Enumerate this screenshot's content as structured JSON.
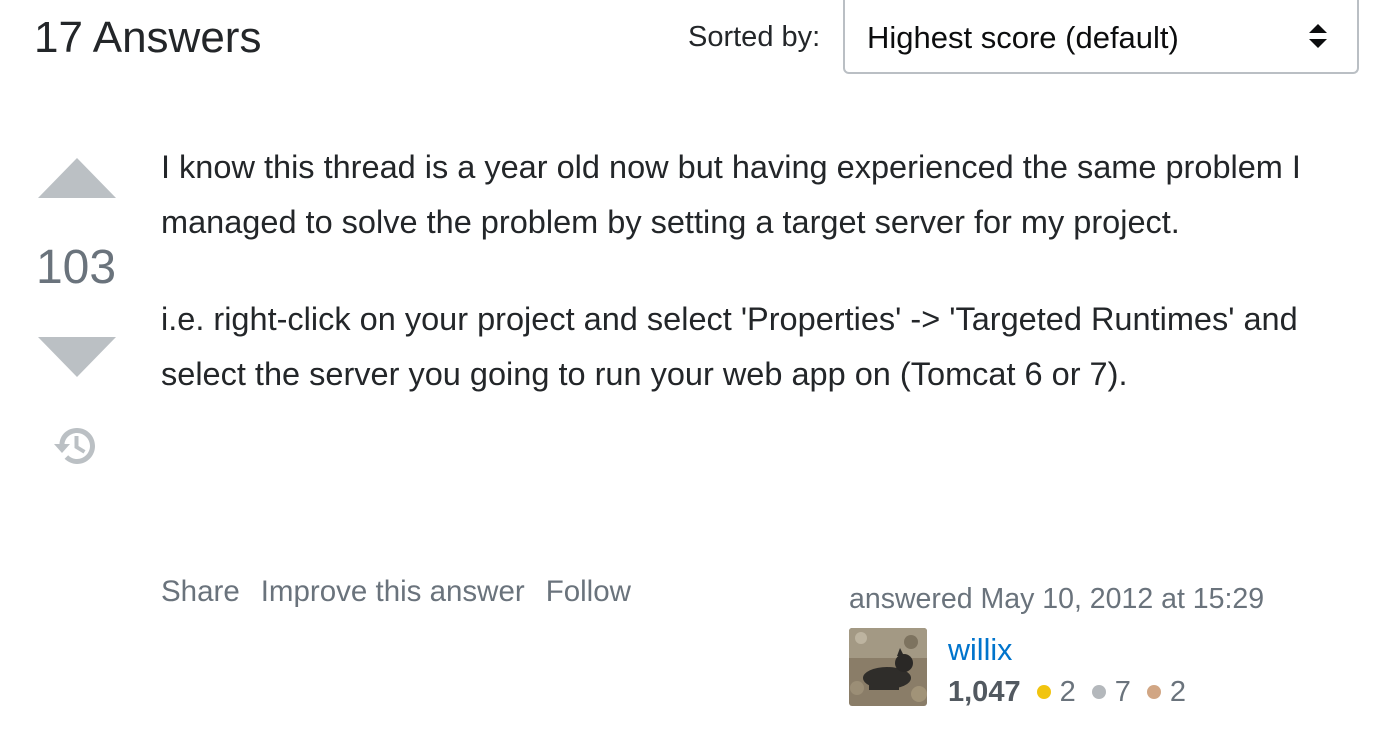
{
  "header": {
    "answers_count": "17 Answers",
    "sort_label": "Sorted by:",
    "sort_value": "Highest score (default)"
  },
  "answer": {
    "score": "103",
    "paragraphs": [
      "I know this thread is a year old now but having experienced the same problem I managed to solve the problem by setting a target server for my project.",
      "i.e. right-click on your project and select 'Properties' -> 'Targeted Runtimes' and select the server you going to run your web app on (Tomcat 6 or 7)."
    ],
    "menu": {
      "share": "Share",
      "improve": "Improve this answer",
      "follow": "Follow"
    },
    "user": {
      "action_time": "answered May 10, 2012 at 15:29",
      "name": "willix",
      "reputation": "1,047",
      "gold": "2",
      "silver": "7",
      "bronze": "2"
    }
  },
  "icons": {
    "vote_up": "arrow-up-icon",
    "vote_down": "arrow-down-icon",
    "history": "history-icon",
    "sort": "sort-arrows-icon"
  },
  "colors": {
    "link": "#0074cc",
    "muted": "#6a737c",
    "vote_arrow": "#bbc0c4",
    "gold": "#f1c40f",
    "silver": "#b4b8bc",
    "bronze": "#d1a684"
  }
}
